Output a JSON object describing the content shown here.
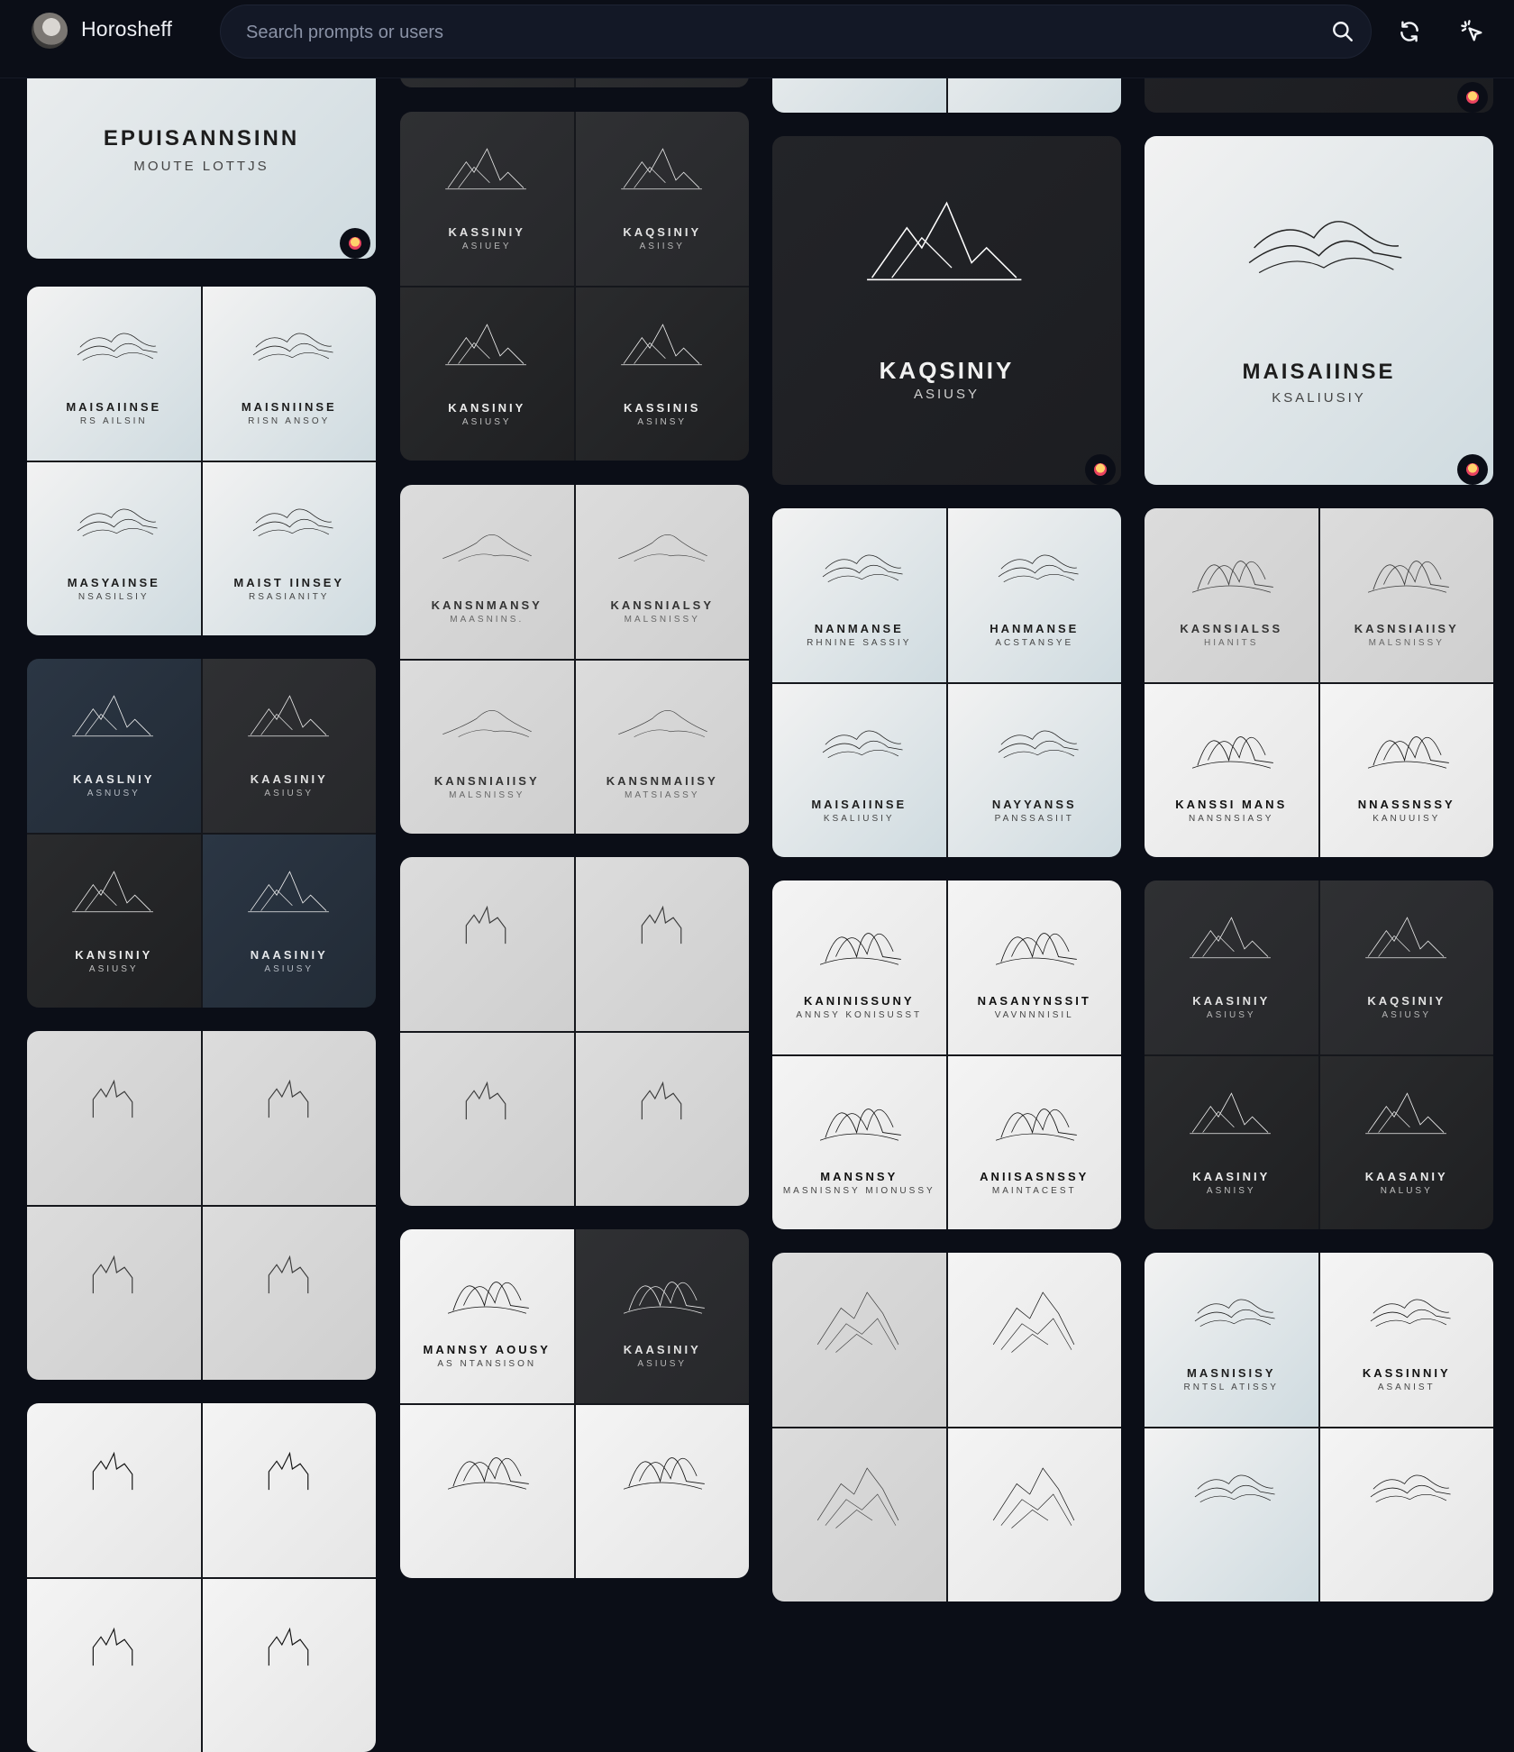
{
  "header": {
    "username": "Horosheff",
    "search_placeholder": "Search prompts or users",
    "icons": {
      "search": "search-icon",
      "refresh": "refresh-icon",
      "cursor": "cursor-click-icon"
    }
  },
  "colors": {
    "background": "#0b0e17",
    "search_bg": "#131826",
    "text": "#eef0f5",
    "placeholder": "#8a92a6"
  },
  "cards": {
    "c0": {
      "title": "EPUISANNSINN",
      "sub": "MOUTE LOTTJS"
    },
    "c1": {
      "t": [
        "MAISAIINSE",
        "MAISNIINSE",
        "MASYAINSE",
        "MAIST IINSEY"
      ],
      "s": [
        "RS AILSIN",
        "RISN ANSOY",
        "NSASILSIY",
        "RSASIANITY"
      ]
    },
    "c2": {
      "t": [
        "KAASLNIY",
        "KAASINIY",
        "KANSINIY",
        "NAASINIY"
      ],
      "s": [
        "ASNUSY",
        "ASIUSY",
        "ASIUSY",
        "ASIUSY"
      ]
    },
    "c3": {},
    "m0": {},
    "m1": {
      "t": [
        "KASSINIY",
        "KAQSINIY",
        "KANSINIY",
        "KASSINIS"
      ],
      "s": [
        "ASIUEY",
        "ASIISY",
        "ASIUSY",
        "ASINSY"
      ]
    },
    "m2": {
      "t": [
        "KANSNMANSY",
        "KANSNIALSY",
        "KANSNIAIISY",
        "KANSNMAIISY"
      ],
      "s": [
        "MAASNINS.",
        "MALSNISSY",
        "MALSNISSY",
        "MATSIASSY"
      ]
    },
    "m3": {},
    "m4": {
      "t": [
        "MANNSY AOUSY",
        "KAASINIY"
      ],
      "s": [
        "AS NTANSISON",
        "ASIUSY"
      ]
    },
    "r0": {
      "title": "KAQSINIY",
      "sub": "ASIUSY"
    },
    "r1": {
      "t": [
        "NANMANSE",
        "HANMANSE",
        "MAISAIINSE",
        "NAYYANSS"
      ],
      "s": [
        "RHNINE SASSIY",
        "ACSTANSYE",
        "KSALIUSIY",
        "PANSSASIIT"
      ]
    },
    "r2": {
      "t": [
        "KANINISSUNY",
        "NASANYNSSIT",
        "MANSNSY",
        "ANIISASNSSY"
      ],
      "s": [
        "ANNSY KONISUSST",
        "VAVNNNISIL",
        "MASNISNSY MIONUSSY",
        "MAINTACEST"
      ]
    },
    "r3": {},
    "s0": {
      "title": "MAISAIINSE",
      "sub": "KSALIUSIY"
    },
    "s1": {
      "t": [
        "KASNSIALSS",
        "KASNSIAIISY",
        "KANSSI MANS",
        "NNASSNSSY"
      ],
      "s": [
        "HIANITS",
        "MALSNISSY",
        "NANSNSIASY",
        "KANUUISY"
      ]
    },
    "s2": {
      "t": [
        "KAASINIY",
        "KAQSINIY",
        "KAASINIY",
        "KAASANIY"
      ],
      "s": [
        "ASIUSY",
        "ASIUSY",
        "ASNISY",
        "NALUSY"
      ]
    },
    "s3": {
      "t": [
        "MASNISISY",
        "KASSINNIY"
      ],
      "s": [
        "RNTSL ATISSY",
        "ASANIST"
      ]
    }
  }
}
